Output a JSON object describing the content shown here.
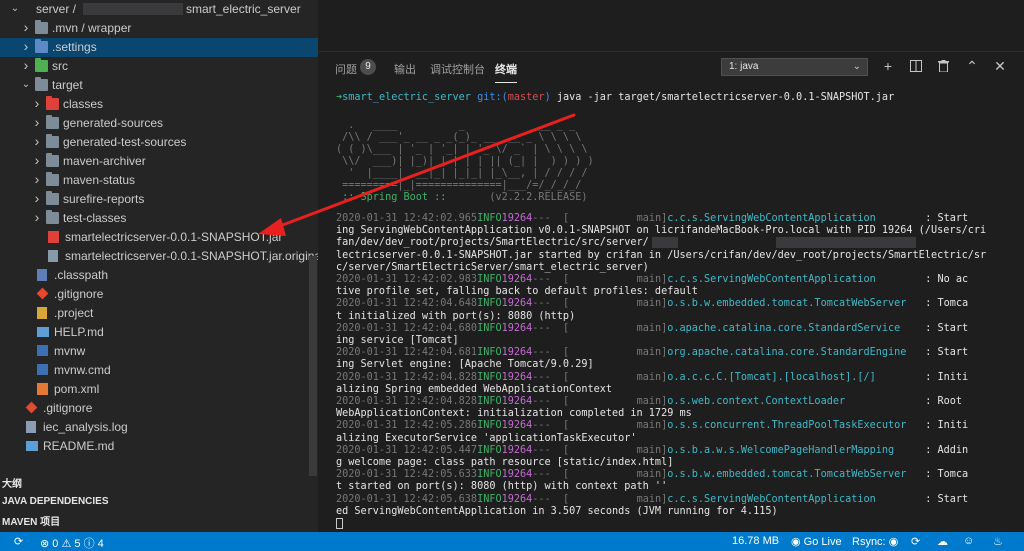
{
  "sidebar": {
    "tree": [
      {
        "label": "server / ",
        "suffix": "smart_electric_server",
        "indent": 0,
        "chev": "v",
        "icon": "none",
        "masked": true
      },
      {
        "label": ".mvn / wrapper",
        "indent": 1,
        "chev": ">",
        "icon": "folder"
      },
      {
        "label": ".settings",
        "indent": 1,
        "chev": ">",
        "icon": "folder-settings",
        "selected": true
      },
      {
        "label": "src",
        "indent": 1,
        "chev": ">",
        "icon": "folder-src"
      },
      {
        "label": "target",
        "indent": 1,
        "chev": "v",
        "icon": "folder-target"
      },
      {
        "label": "classes",
        "indent": 2,
        "chev": ">",
        "icon": "folder-classes"
      },
      {
        "label": "generated-sources",
        "indent": 2,
        "chev": ">",
        "icon": "folder"
      },
      {
        "label": "generated-test-sources",
        "indent": 2,
        "chev": ">",
        "icon": "folder"
      },
      {
        "label": "maven-archiver",
        "indent": 2,
        "chev": ">",
        "icon": "folder"
      },
      {
        "label": "maven-status",
        "indent": 2,
        "chev": ">",
        "icon": "folder"
      },
      {
        "label": "surefire-reports",
        "indent": 2,
        "chev": ">",
        "icon": "folder"
      },
      {
        "label": "test-classes",
        "indent": 2,
        "chev": ">",
        "icon": "folder"
      },
      {
        "label": "smartelectricserver-0.0.1-SNAPSHOT.jar",
        "indent": 2,
        "chev": "",
        "icon": "file-jar"
      },
      {
        "label": "smartelectricserver-0.0.1-SNAPSHOT.jar.original",
        "indent": 2,
        "chev": "",
        "icon": "file-orig"
      },
      {
        "label": ".classpath",
        "indent": 1,
        "chev": "",
        "icon": "file-classpath"
      },
      {
        "label": ".gitignore",
        "indent": 1,
        "chev": "",
        "icon": "file-git"
      },
      {
        "label": ".project",
        "indent": 1,
        "chev": "",
        "icon": "file-project"
      },
      {
        "label": "HELP.md",
        "indent": 1,
        "chev": "",
        "icon": "file-md"
      },
      {
        "label": "mvnw",
        "indent": 1,
        "chev": "",
        "icon": "file-sh"
      },
      {
        "label": "mvnw.cmd",
        "indent": 1,
        "chev": "",
        "icon": "file-sh"
      },
      {
        "label": "pom.xml",
        "indent": 1,
        "chev": "",
        "icon": "file-xml"
      },
      {
        "label": ".gitignore",
        "indent": 0,
        "chev": "",
        "icon": "file-git"
      },
      {
        "label": "iec_analysis.log",
        "indent": 0,
        "chev": "",
        "icon": "file-log"
      },
      {
        "label": "README.md",
        "indent": 0,
        "chev": "",
        "icon": "file-md"
      }
    ],
    "sections": [
      "大纲",
      "JAVA DEPENDENCIES",
      "MAVEN 项目"
    ]
  },
  "panel": {
    "tabs": [
      "问题",
      "输出",
      "调试控制台",
      "终端"
    ],
    "problems_count": "9",
    "active_tab": "终端",
    "terminal_select": "1: java",
    "tool_icons": [
      "plus-icon",
      "split-icon",
      "trash-icon",
      "chevron-up-icon",
      "close-icon"
    ]
  },
  "terminal": {
    "prompt": {
      "arrow": "➜",
      "dir": "smart_electric_server",
      "git": "git:(",
      "branch": "master",
      "git_close": ")",
      "command": "java -jar target/smartelectricserver-0.0.1-SNAPSHOT.jar"
    },
    "banner": [
      "  .   ____          _            __ _ _",
      " /\\\\ / ___'_ __ _ _(_)_ __  __ _ \\ \\ \\ \\",
      "( ( )\\___ | '_ | '_| | '_ \\/ _` | \\ \\ \\ \\",
      " \\\\/  ___)| |_)| | | | | || (_| |  ) ) ) )",
      "  '  |____| .__|_| |_|_| |_\\__, | / / / /",
      " =========|_|==============|___/=/_/_/_/"
    ],
    "boot_label": " :: Spring Boot ::",
    "boot_version": "       (v2.2.2.RELEASE)",
    "logs": [
      {
        "ts": "2020-01-31 12:42:02.965",
        "level": "INFO",
        "pid": "19264",
        "thread": "---  [           main]",
        "logger": "c.c.s.ServingWebContentApplication",
        "msg": ": Start",
        "cont": [
          "ing ServingWebContentApplication v0.0.1-SNAPSHOT on licrifandeMacBook-Pro.local with PID 19264 (/Users/cri",
          "fan/dev/dev_root/projects/SmartElectric/src/server/                        /target/smarte",
          "lectricserver-0.0.1-SNAPSHOT.jar started by crifan in /Users/crifan/dev/dev_root/projects/SmartElectric/sr",
          "c/server/SmartElectricServer/smart_electric_server)"
        ]
      },
      {
        "ts": "2020-01-31 12:42:02.983",
        "level": "INFO",
        "pid": "19264",
        "thread": "---  [           main]",
        "logger": "c.c.s.ServingWebContentApplication",
        "msg": ": No ac",
        "cont": [
          "tive profile set, falling back to default profiles: default"
        ]
      },
      {
        "ts": "2020-01-31 12:42:04.648",
        "level": "INFO",
        "pid": "19264",
        "thread": "---  [           main]",
        "logger": "o.s.b.w.embedded.tomcat.TomcatWebServer",
        "msg": ": Tomca",
        "cont": [
          "t initialized with port(s): 8080 (http)"
        ]
      },
      {
        "ts": "2020-01-31 12:42:04.680",
        "level": "INFO",
        "pid": "19264",
        "thread": "---  [           main]",
        "logger": "o.apache.catalina.core.StandardService",
        "msg": ": Start",
        "cont": [
          "ing service [Tomcat]"
        ]
      },
      {
        "ts": "2020-01-31 12:42:04.681",
        "level": "INFO",
        "pid": "19264",
        "thread": "---  [           main]",
        "logger": "org.apache.catalina.core.StandardEngine",
        "msg": ": Start",
        "cont": [
          "ing Servlet engine: [Apache Tomcat/9.0.29]"
        ]
      },
      {
        "ts": "2020-01-31 12:42:04.828",
        "level": "INFO",
        "pid": "19264",
        "thread": "---  [           main]",
        "logger": "o.a.c.c.C.[Tomcat].[localhost].[/]",
        "msg": ": Initi",
        "cont": [
          "alizing Spring embedded WebApplicationContext"
        ]
      },
      {
        "ts": "2020-01-31 12:42:04.828",
        "level": "INFO",
        "pid": "19264",
        "thread": "---  [           main]",
        "logger": "o.s.web.context.ContextLoader",
        "msg": ": Root",
        "cont": [
          "WebApplicationContext: initialization completed in 1729 ms"
        ]
      },
      {
        "ts": "2020-01-31 12:42:05.286",
        "level": "INFO",
        "pid": "19264",
        "thread": "---  [           main]",
        "logger": "o.s.s.concurrent.ThreadPoolTaskExecutor",
        "msg": ": Initi",
        "cont": [
          "alizing ExecutorService 'applicationTaskExecutor'"
        ]
      },
      {
        "ts": "2020-01-31 12:42:05.447",
        "level": "INFO",
        "pid": "19264",
        "thread": "---  [           main]",
        "logger": "o.s.b.a.w.s.WelcomePageHandlerMapping",
        "msg": ": Addin",
        "cont": [
          "g welcome page: class path resource [static/index.html]"
        ]
      },
      {
        "ts": "2020-01-31 12:42:05.633",
        "level": "INFO",
        "pid": "19264",
        "thread": "---  [           main]",
        "logger": "o.s.b.w.embedded.tomcat.TomcatWebServer",
        "msg": ": Tomca",
        "cont": [
          "t started on port(s): 8080 (http) with context path ''"
        ]
      },
      {
        "ts": "2020-01-31 12:42:05.638",
        "level": "INFO",
        "pid": "19264",
        "thread": "---  [           main]",
        "logger": "c.c.s.ServingWebContentApplication",
        "msg": ": Start",
        "cont": [
          "ed ServingWebContentApplication in 3.507 seconds (JVM running for 4.115)"
        ]
      }
    ]
  },
  "status": {
    "errors": "0",
    "warnings": "5",
    "infos": "4",
    "memory": "16.78 MB",
    "go_live": "Go Live",
    "rsync": "Rsync:"
  },
  "colors": {
    "statusbar": "#007acc",
    "selection": "#094771",
    "annotation_arrow": "#e8201f"
  }
}
